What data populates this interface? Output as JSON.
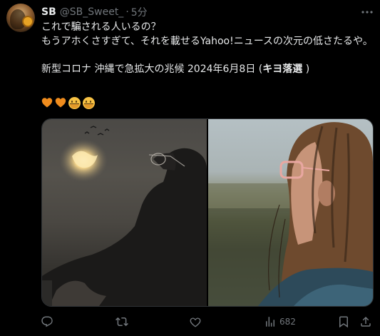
{
  "post": {
    "display_name": "SB",
    "handle": "@SB_Sweet_",
    "separator": "·",
    "timestamp": "5分",
    "text_lines": [
      "これで騙される人いるの？",
      "もうアホくさすぎて、それを載せるYahoo!ニュースの次元の低さたるや。",
      "",
      "新型コロナ 沖縄で急拡大の兆候 2024年6月8日 (",
      "キヨ落選",
      " )"
    ],
    "emojis": [
      "orange-heart-icon",
      "orange-heart-icon",
      "hugging-face-icon",
      "hugging-face-icon"
    ]
  },
  "actions": {
    "reply_count": "",
    "repost_count": "",
    "like_count": "",
    "views_count": "682"
  },
  "colors": {
    "background": "#000000",
    "text": "#e7e9ea",
    "muted": "#71767b",
    "heart": "#f08c1d"
  }
}
